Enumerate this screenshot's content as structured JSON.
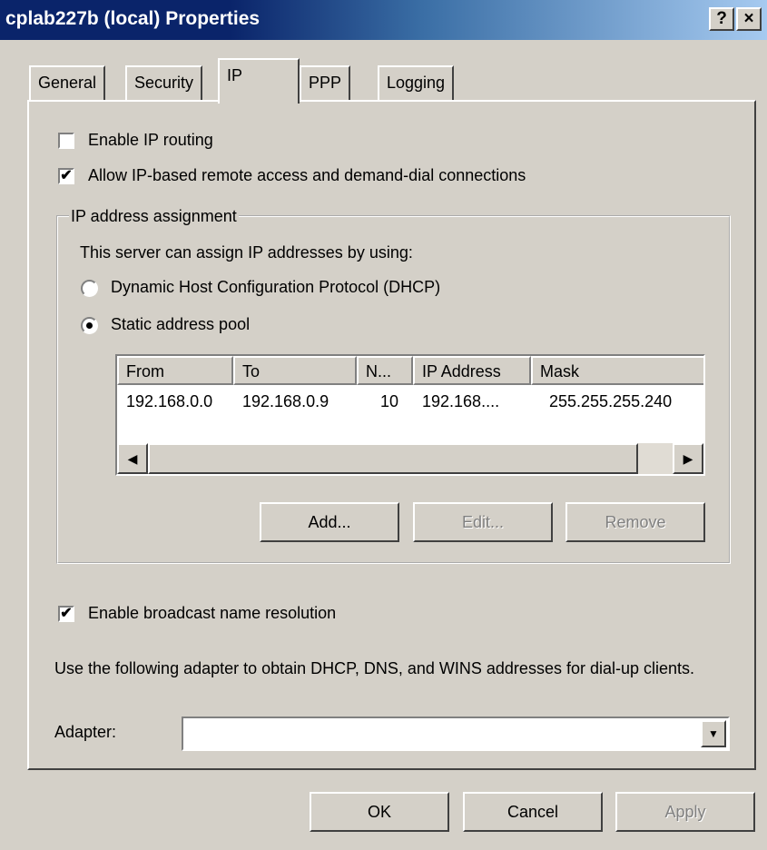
{
  "window": {
    "title": "cplab227b (local) Properties",
    "help_btn": "?",
    "close_btn": "×"
  },
  "tabs": [
    {
      "label": "General"
    },
    {
      "label": "Security"
    },
    {
      "label": "IP",
      "active": true
    },
    {
      "label": "PPP"
    },
    {
      "label": "Logging"
    }
  ],
  "options": {
    "enable_ip_routing": {
      "label": "Enable IP routing",
      "checked": false
    },
    "allow_ip_remote": {
      "label": "Allow IP-based remote access and demand-dial connections",
      "checked": true
    }
  },
  "ip_assignment": {
    "group_title": "IP address assignment",
    "intro": "This server can assign IP addresses by using:",
    "dhcp_label": "Dynamic Host Configuration Protocol (DHCP)",
    "dhcp_selected": false,
    "static_label": "Static address pool",
    "static_selected": true,
    "columns": [
      "From",
      "To",
      "N...",
      "IP Address",
      "Mask"
    ],
    "rows": [
      {
        "from": "192.168.0.0",
        "to": "192.168.0.9",
        "n": "10",
        "ip": "192.168....",
        "mask": "255.255.255.240"
      }
    ],
    "add_label": "Add...",
    "edit_label": "Edit...",
    "remove_label": "Remove"
  },
  "broadcast": {
    "label": "Enable broadcast name resolution",
    "checked": true
  },
  "adapter_note": "Use the following adapter to obtain DHCP, DNS, and WINS addresses for dial-up clients.",
  "adapter": {
    "label": "Adapter:",
    "value": ""
  },
  "footer": {
    "ok": "OK",
    "cancel": "Cancel",
    "apply": "Apply"
  }
}
